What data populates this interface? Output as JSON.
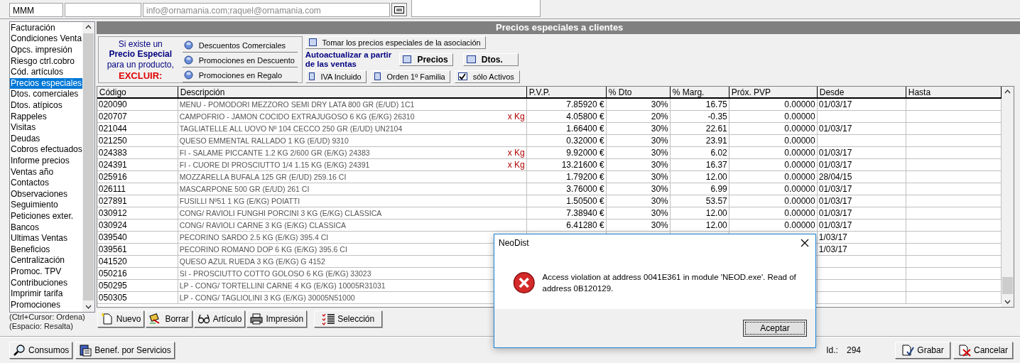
{
  "customer": {
    "code": "MMM",
    "email": "info@ornamania.com;raquel@ornamania.com"
  },
  "sidebar": {
    "items": [
      {
        "label": "Facturación",
        "selected": false
      },
      {
        "label": "Condiciones Venta",
        "selected": false
      },
      {
        "label": "Opcs. impresión",
        "selected": false
      },
      {
        "label": "Riesgo ctrl.cobro",
        "selected": false
      },
      {
        "label": "Cód. artículos",
        "selected": false
      },
      {
        "label": "Precios especiales",
        "selected": true
      },
      {
        "label": "Dtos. comerciales",
        "selected": false
      },
      {
        "label": "Dtos. atípicos",
        "selected": false
      },
      {
        "label": "Rappeles",
        "selected": false
      },
      {
        "label": "Visitas",
        "selected": false
      },
      {
        "label": "Deudas",
        "selected": false
      },
      {
        "label": "Cobros efectuados",
        "selected": false
      },
      {
        "label": "Informe precios",
        "selected": false
      },
      {
        "label": "Ventas año",
        "selected": false
      },
      {
        "label": "Contactos",
        "selected": false
      },
      {
        "label": "Observaciones",
        "selected": false
      },
      {
        "label": "Seguimiento",
        "selected": false
      },
      {
        "label": "Peticiones exter.",
        "selected": false
      },
      {
        "label": "Bancos",
        "selected": false
      },
      {
        "label": "Ultimas Ventas",
        "selected": false
      },
      {
        "label": "Beneficios",
        "selected": false
      },
      {
        "label": "Centralización",
        "selected": false
      },
      {
        "label": "Promoc. TPV",
        "selected": false
      },
      {
        "label": "Contribuciones",
        "selected": false
      },
      {
        "label": "Imprimir tarifa",
        "selected": false
      },
      {
        "label": "Promociones",
        "selected": false
      }
    ],
    "hints": [
      "(Ctrl+Cursor: Ordena)",
      "(Espacio: Resalta)"
    ]
  },
  "panel_title": "Precios especiales a clientes",
  "exclude": {
    "lines": [
      {
        "text": "Si existe un",
        "kind": "normal"
      },
      {
        "text": "Precio Especial",
        "kind": "bold"
      },
      {
        "text": "para un producto,",
        "kind": "normal"
      },
      {
        "text": "EXCLUIR:",
        "kind": "alert"
      }
    ],
    "options": [
      "Descuentos Comerciales",
      "Promociones en Descuento",
      "Promociones en Regalo"
    ]
  },
  "take_association": {
    "label": "Tomar los precios especiales de la asociación",
    "checked": false
  },
  "autoupdate": {
    "label": "Autoactualizar a partir de las ventas",
    "top": [
      {
        "label": "Precios",
        "checked": false
      },
      {
        "label": "Dtos.",
        "checked": false
      }
    ],
    "bottom": [
      {
        "label": "IVA Incluido",
        "checked": false
      },
      {
        "label": "Orden 1º Familia",
        "checked": false
      },
      {
        "label": "sólo Activos",
        "checked": true
      }
    ]
  },
  "table": {
    "columns": [
      "Código",
      "Descripción",
      "P.V.P.",
      "% Dto",
      "% Marg.",
      "Próx. PVP",
      "Desde",
      "Hasta"
    ],
    "rows": [
      {
        "codigo": "020090",
        "descripcion": "MENU - POMODORI MEZZORO SEMI DRY LATA 800 GR (E/UD) 1C1",
        "pvp": "7.85920 €",
        "dto": "30%",
        "marg": "16.75",
        "prox": "0.00000",
        "desde": "01/03/17"
      },
      {
        "codigo": "020707",
        "descripcion": "CAMPOFRIO - JAMON COCIDO EXTRAJUGOSO 6 KG (E/KG) 26310",
        "unit": "x Kg",
        "pvp": "4.05800 €",
        "dto": "20%",
        "marg": "-0.35",
        "prox": "0.00000"
      },
      {
        "codigo": "021044",
        "descripcion": "TAGLIATELLE ALL UOVO Nº 104 CECCO 250 GR (E/UD) UN2104",
        "pvp": "1.66400 €",
        "dto": "30%",
        "marg": "22.61",
        "prox": "0.00000",
        "desde": "01/03/17"
      },
      {
        "codigo": "021250",
        "descripcion": "QUESO EMMENTAL RALLADO 1 KG (E/UD) 9310",
        "pvp": "0.32000 €",
        "dto": "30%",
        "marg": "23.91",
        "prox": "0.00000"
      },
      {
        "codigo": "024383",
        "descripcion": "FI - SALAME PICCANTE 1.2 KG 2/600 GR (E/KG) 24383",
        "unit": "x Kg",
        "pvp": "9.92000 €",
        "dto": "30%",
        "marg": "6.02",
        "prox": "0.00000",
        "desde": "01/03/17"
      },
      {
        "codigo": "024391",
        "descripcion": "FI - CUORE DI PROSCIUTTO 1/4 1.15 KG (E/KG) 24391",
        "unit": "x Kg",
        "pvp": "13.21600 €",
        "dto": "30%",
        "marg": "16.37",
        "prox": "0.00000",
        "desde": "01/03/17"
      },
      {
        "codigo": "025916",
        "descripcion": "MOZZARELLA BUFALA 125 GR (E/UD) 259.16 CI",
        "pvp": "1.79200 €",
        "dto": "30%",
        "marg": "12.00",
        "prox": "0.00000",
        "desde": "28/04/15"
      },
      {
        "codigo": "026111",
        "descripcion": "MASCARPONE 500 GR (E/UD) 261 CI",
        "pvp": "3.76000 €",
        "dto": "30%",
        "marg": "6.99",
        "prox": "0.00000",
        "desde": "01/03/17"
      },
      {
        "codigo": "027891",
        "descripcion": "FUSILLI Nº51 1 KG (E/KG) POIATTI",
        "pvp": "1.50500 €",
        "dto": "30%",
        "marg": "53.57",
        "prox": "0.00000",
        "desde": "01/03/17"
      },
      {
        "codigo": "030912",
        "descripcion": "CONG/ RAVIOLI FUNGHI PORCINI 3 KG (E/KG) CLASSICA",
        "pvp": "7.38940 €",
        "dto": "30%",
        "marg": "12.00",
        "prox": "0.00000",
        "desde": "01/03/17"
      },
      {
        "codigo": "030924",
        "descripcion": "CONG/ RAVIOLI CARNE 3 KG (E/KG) CLASSICA",
        "pvp": "6.41280 €",
        "dto": "30%",
        "marg": "12.00",
        "prox": "0.00000",
        "desde": "01/03/17"
      },
      {
        "codigo": "039540",
        "descripcion": "PECORINO SARDO 2.5 KG (E/KG) 395.4 CI",
        "desde": "1/03/17"
      },
      {
        "codigo": "039561",
        "descripcion": "PECORINO ROMANO DOP 6 KG (E/KG) 395.6 CI",
        "desde": "1/03/17"
      },
      {
        "codigo": "041520",
        "descripcion": "QUESO AZUL RUEDA 3 KG (E/KG) G 4152"
      },
      {
        "codigo": "050216",
        "descripcion": "SI - PROSCIUTTO COTTO GOLOSO 6 KG (E/KG) 33023"
      },
      {
        "codigo": "050295",
        "descripcion": "LP - CONG/ TORTELLINI CARNE 4 KG (E/KG) 10005R31031"
      },
      {
        "codigo": "050305",
        "descripcion": "LP - CONG/ TAGLIOLINI 3 KG (E/KG) 30005N51000"
      }
    ]
  },
  "actions": [
    {
      "label": "Nuevo",
      "kind": "new"
    },
    {
      "label": "Borrar",
      "kind": "erase"
    },
    {
      "label": "Artículo",
      "kind": "glasses"
    },
    {
      "label": "Impresión",
      "kind": "print"
    },
    {
      "label": "Selección",
      "kind": "select"
    }
  ],
  "footer": {
    "buttons": [
      {
        "label": "Consumos",
        "kind": "search"
      },
      {
        "label": "Benef. por Servicios",
        "kind": "clipboard"
      }
    ],
    "id_label": "Id.:",
    "id_value": "294",
    "commands": [
      {
        "label": "Grabar",
        "kind": "save"
      },
      {
        "label": "Cancelar",
        "kind": "cancel"
      }
    ]
  },
  "dialog": {
    "title": "NeoDist",
    "message": "Access violation at address 0041E361 in module 'NEOD.exe'. Read of address 0B120129.",
    "button": "Aceptar"
  }
}
